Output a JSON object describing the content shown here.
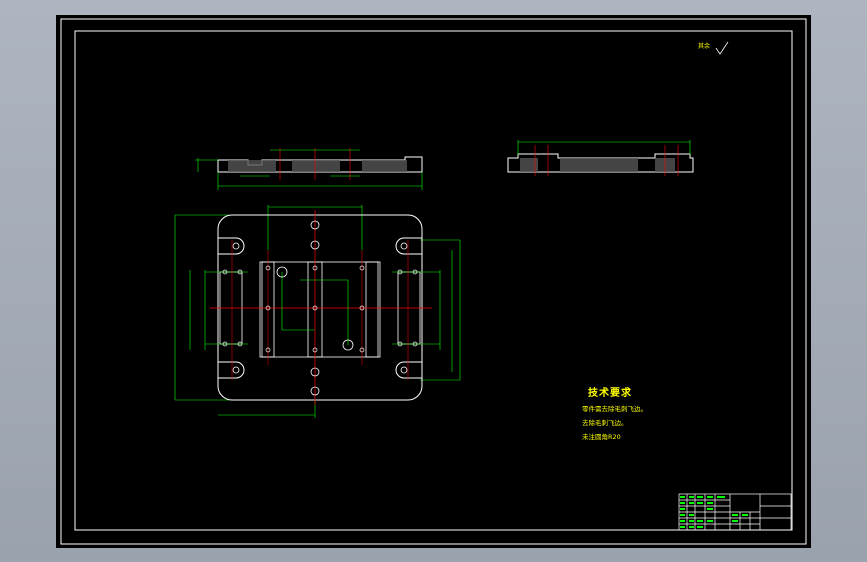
{
  "drawing": {
    "background": "#000000",
    "frame_color": "#ffffff",
    "line_color": "#00ff00",
    "center_color": "#ff0000",
    "outline_color": "#ffffff",
    "text_color": "#ffff00"
  },
  "roughness_note": {
    "label": "其余"
  },
  "technical_requirements": {
    "title": "技术要求",
    "lines": [
      "零件需去除毛刺飞边。",
      "去除毛刺飞边。",
      "未注圆角R20"
    ]
  }
}
